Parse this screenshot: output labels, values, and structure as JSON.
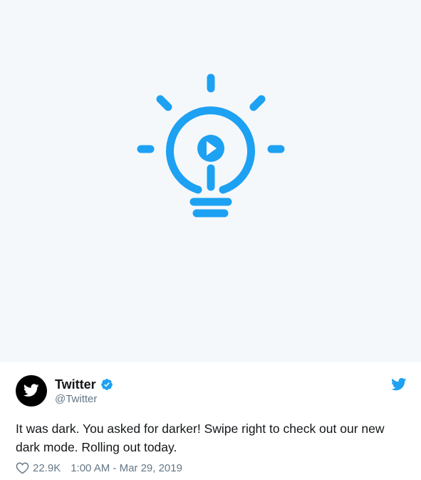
{
  "tweet": {
    "author": {
      "display_name": "Twitter",
      "handle": "@Twitter",
      "verified": true,
      "avatar_icon": "twitter-bird-icon"
    },
    "text": "It was dark. You asked for darker! Swipe right to check out our new dark mode. Rolling out today.",
    "likes": "22.9K",
    "timestamp": "1:00 AM - Mar 29, 2019"
  },
  "media": {
    "type": "video",
    "icon": "lightbulb-icon",
    "play_icon": "play-icon"
  },
  "colors": {
    "brand_blue": "#1da1f2",
    "media_background": "#f5f8fa",
    "text_primary": "#14171a",
    "text_secondary": "#657786",
    "avatar_background": "#000000"
  }
}
